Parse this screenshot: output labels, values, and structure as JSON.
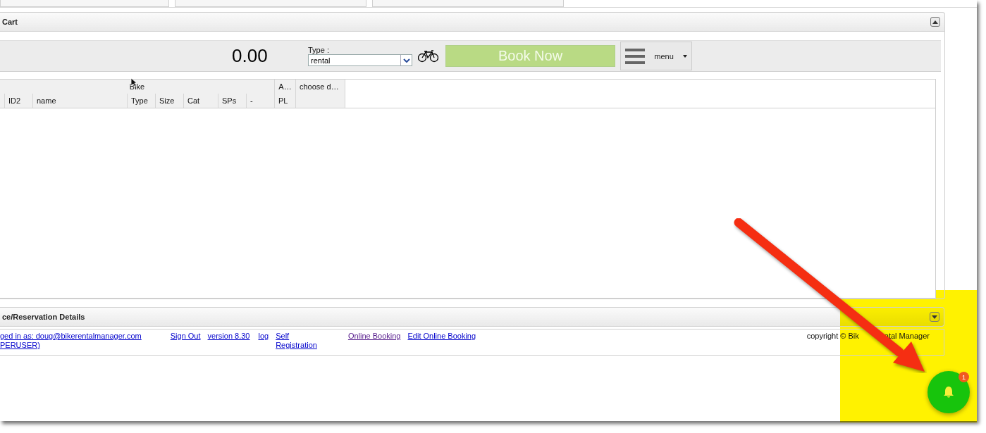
{
  "cart_panel": {
    "title": "Cart",
    "expanded": true
  },
  "toolbar": {
    "total": "0.00",
    "type_label": "Type :",
    "type_value": "rental",
    "book_button": "Book Now",
    "menu_label": "menu"
  },
  "table": {
    "group_headers": [
      "Bike",
      "A…"
    ],
    "corner_header": "choose d…",
    "columns": [
      "",
      "ID2",
      "name",
      "Type",
      "Size",
      "Cat",
      "SPs",
      "-",
      "PL"
    ]
  },
  "details_panel": {
    "title": "ce/Reservation Details",
    "expanded": false
  },
  "footer": {
    "links": [
      {
        "lines": [
          "ged in as: doug@bikerentalmanager.com",
          "PERUSER)"
        ],
        "visited": false
      },
      {
        "lines": [
          "Sign Out"
        ],
        "visited": false
      },
      {
        "lines": [
          "version 8.30"
        ],
        "visited": false
      },
      {
        "lines": [
          "log"
        ],
        "visited": false
      },
      {
        "lines": [
          "Self",
          "Registration"
        ],
        "visited": false
      },
      {
        "lines": [
          "Online Booking"
        ],
        "visited": true
      },
      {
        "lines": [
          "Edit Online Booking"
        ],
        "visited": false
      }
    ],
    "copyright_parts": [
      "copyright © Bik",
      "ntal Manager"
    ]
  },
  "notifications": {
    "count": "1"
  }
}
